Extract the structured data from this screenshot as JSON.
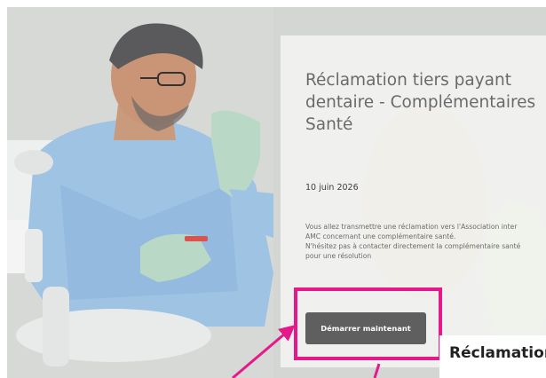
{
  "card": {
    "title": "Réclamation tiers payant dentaire - Complémentaires Santé",
    "date": "10 juin 2026",
    "body_line1": "Vous allez transmettre une réclamation vers l'Association inter AMC concernant une complémentaire santé.",
    "body_line2": "N'hésitez pas à contacter directement la complémentaire santé pour une résolution",
    "button_label": "Démarrer maintenant"
  },
  "bottom_heading": "Réclamation",
  "colors": {
    "highlight": "#e5198a",
    "button_bg": "#5f5f5f",
    "card_bg": "#f8f8f6"
  },
  "icons": {
    "annotation": "pointer-arrow-icon"
  }
}
